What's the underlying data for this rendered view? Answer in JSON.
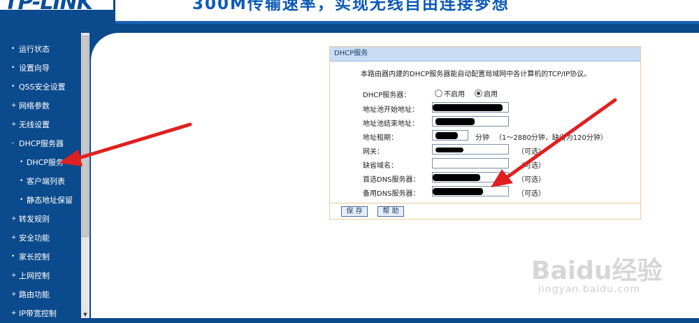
{
  "header": {
    "logo": "TP-LINK",
    "slogan": "300M传输速率，实现无线自由连接梦想"
  },
  "sidebar": {
    "items": [
      {
        "label": "运行状态",
        "bullet": "•"
      },
      {
        "label": "设置向导",
        "bullet": "•"
      },
      {
        "label": "QSS安全设置",
        "bullet": "•"
      },
      {
        "label": "网络参数",
        "bullet": "+"
      },
      {
        "label": "无线设置",
        "bullet": "+"
      },
      {
        "label": "DHCP服务器",
        "bullet": "–"
      },
      {
        "label": "DHCP服务",
        "bullet": "•",
        "sub": true,
        "active": true
      },
      {
        "label": "客户端列表",
        "bullet": "•",
        "sub": true
      },
      {
        "label": "静态地址保留",
        "bullet": "•",
        "sub": true
      },
      {
        "label": "转发规则",
        "bullet": "+"
      },
      {
        "label": "安全功能",
        "bullet": "+"
      },
      {
        "label": "家长控制",
        "bullet": "•"
      },
      {
        "label": "上网控制",
        "bullet": "+"
      },
      {
        "label": "路由功能",
        "bullet": "+"
      },
      {
        "label": "IP带宽控制",
        "bullet": "+"
      }
    ],
    "scroll_down_icon": "▼"
  },
  "panel": {
    "title": "DHCP服务",
    "description": "本路由器内建的DHCP服务器能自动配置局域网中各计算机的TCP/IP协议。",
    "dhcp_server_label": "DHCP服务器：",
    "option_disable": "不启用",
    "option_enable": "启用",
    "selected": "启用",
    "start_addr_label": "地址池开始地址：",
    "end_addr_label": "地址池结束地址：",
    "lease_label": "地址租期：",
    "lease_unit": "分钟",
    "lease_hint": "（1～2880分钟，缺省为120分钟）",
    "gateway_label": "网关：",
    "domain_label": "缺省域名：",
    "primary_dns_label": "首选DNS服务器：",
    "secondary_dns_label": "备用DNS服务器：",
    "optional": "（可选）",
    "save_button": "保 存",
    "help_button": "帮 助"
  },
  "watermark": {
    "brand": "Baidu经验",
    "url": "jingyan.baidu.com"
  },
  "colors": {
    "frame_blue": "#0b4a8c",
    "panel_border": "#f0c89a",
    "panel_title_bg": "#c8dcf4",
    "arrow_red": "#e02020"
  }
}
